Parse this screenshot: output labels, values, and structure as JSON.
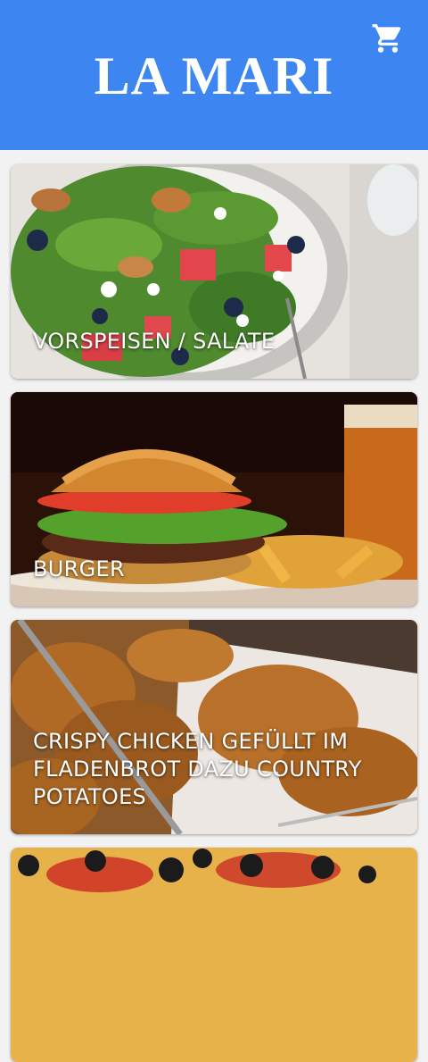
{
  "app": {
    "title": "LA MARI",
    "brand_color": "#3d85f0"
  },
  "header": {
    "cart_icon": "shopping-cart-icon"
  },
  "categories": [
    {
      "label": "VORSPEISEN / SALATE"
    },
    {
      "label": "BURGER"
    },
    {
      "label": "CRISPY CHICKEN GEFÜLLT IM FLADENBROT DAZU COUNTRY POTATOES"
    },
    {
      "label": ""
    }
  ]
}
